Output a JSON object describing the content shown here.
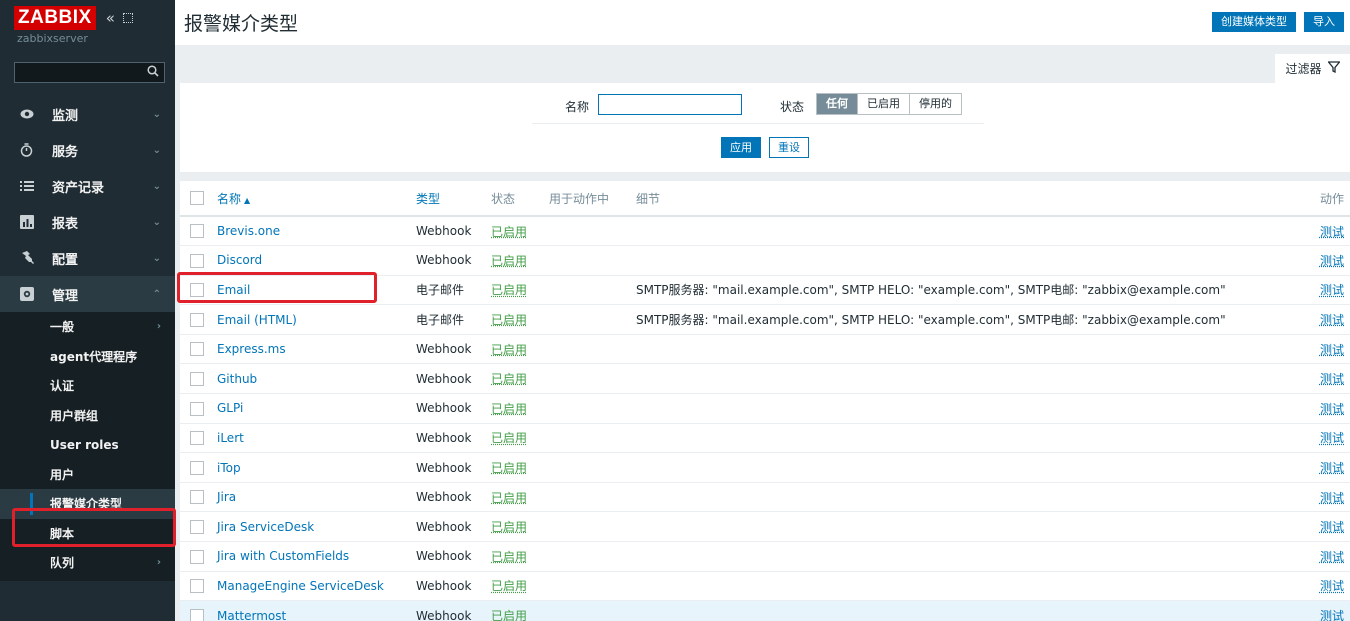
{
  "app": {
    "logo": "ZABBIX",
    "server_name": "zabbixserver",
    "collapse_glyph": "«",
    "search_icon": "search-icon"
  },
  "sidebar": {
    "search_value": "",
    "items": [
      {
        "label": "监测",
        "icon": "eye-icon",
        "glyph": "◉"
      },
      {
        "label": "服务",
        "icon": "clock-icon",
        "glyph": "⏱"
      },
      {
        "label": "资产记录",
        "icon": "list-icon",
        "glyph": "☰"
      },
      {
        "label": "报表",
        "icon": "bar-chart-icon",
        "glyph": "▥"
      },
      {
        "label": "配置",
        "icon": "wrench-icon",
        "glyph": "🔧"
      },
      {
        "label": "管理",
        "icon": "gear-box-icon",
        "glyph": "⚙"
      }
    ],
    "admin_sub": [
      {
        "label": "一般"
      },
      {
        "label": "agent代理程序"
      },
      {
        "label": "认证"
      },
      {
        "label": "用户群组"
      },
      {
        "label": "User roles"
      },
      {
        "label": "用户"
      },
      {
        "label": "报警媒介类型"
      },
      {
        "label": "脚本"
      },
      {
        "label": "队列"
      }
    ]
  },
  "header": {
    "title": "报警媒介类型",
    "create_button": "创建媒体类型",
    "import_button": "导入"
  },
  "filter": {
    "tab_label": "过滤器",
    "name_label": "名称",
    "name_value": "",
    "status_label": "状态",
    "status_options": [
      "任何",
      "已启用",
      "停用的"
    ],
    "status_selected": "任何",
    "apply_button": "应用",
    "reset_button": "重设"
  },
  "table": {
    "columns": {
      "name": "名称",
      "sort_arrow": "▲",
      "type": "类型",
      "status": "状态",
      "used_in_actions": "用于动作中",
      "details": "细节",
      "actions": "动作"
    },
    "rows": [
      {
        "name": "Brevis.one",
        "type": "Webhook",
        "status": "已启用",
        "details": "",
        "action": "测试"
      },
      {
        "name": "Discord",
        "type": "Webhook",
        "status": "已启用",
        "details": "",
        "action": "测试"
      },
      {
        "name": "Email",
        "type": "电子邮件",
        "status": "已启用",
        "details": "SMTP服务器: \"mail.example.com\", SMTP HELO: \"example.com\", SMTP电邮: \"zabbix@example.com\"",
        "action": "测试"
      },
      {
        "name": "Email (HTML)",
        "type": "电子邮件",
        "status": "已启用",
        "details": "SMTP服务器: \"mail.example.com\", SMTP HELO: \"example.com\", SMTP电邮: \"zabbix@example.com\"",
        "action": "测试"
      },
      {
        "name": "Express.ms",
        "type": "Webhook",
        "status": "已启用",
        "details": "",
        "action": "测试"
      },
      {
        "name": "Github",
        "type": "Webhook",
        "status": "已启用",
        "details": "",
        "action": "测试"
      },
      {
        "name": "GLPi",
        "type": "Webhook",
        "status": "已启用",
        "details": "",
        "action": "测试"
      },
      {
        "name": "iLert",
        "type": "Webhook",
        "status": "已启用",
        "details": "",
        "action": "测试"
      },
      {
        "name": "iTop",
        "type": "Webhook",
        "status": "已启用",
        "details": "",
        "action": "测试"
      },
      {
        "name": "Jira",
        "type": "Webhook",
        "status": "已启用",
        "details": "",
        "action": "测试"
      },
      {
        "name": "Jira ServiceDesk",
        "type": "Webhook",
        "status": "已启用",
        "details": "",
        "action": "测试"
      },
      {
        "name": "Jira with CustomFields",
        "type": "Webhook",
        "status": "已启用",
        "details": "",
        "action": "测试"
      },
      {
        "name": "ManageEngine ServiceDesk",
        "type": "Webhook",
        "status": "已启用",
        "details": "",
        "action": "测试"
      },
      {
        "name": "Mattermost",
        "type": "Webhook",
        "status": "已启用",
        "details": "",
        "action": "测试"
      }
    ]
  },
  "colors": {
    "sidebar_bg": "#1f2c33",
    "accent": "#0275b8",
    "logo_red": "#d40000",
    "enabled_green": "#429e47",
    "annotation_red": "#e0202a"
  }
}
